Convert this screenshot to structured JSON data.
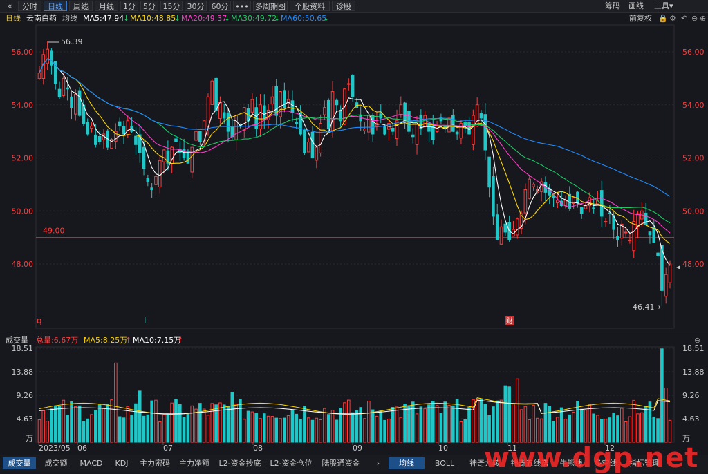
{
  "toolbar": {
    "back": "«",
    "tabs": [
      "分时",
      "日线",
      "周线",
      "月线",
      "1分",
      "5分",
      "15分",
      "30分",
      "60分",
      "•••",
      "多周期图",
      "个股资料",
      "诊股"
    ],
    "active_tab": "日线",
    "right": [
      "筹码",
      "画线",
      "工具▾"
    ]
  },
  "info": {
    "period": "日线",
    "name": "云南白药",
    "ma_label": "均线",
    "ma5": "MA5:47.94",
    "ma10": "MA10:48.85",
    "ma20": "MA20:49.37",
    "ma30": "MA30:49.72",
    "ma60": "MA60:50.65",
    "fq": "前复权"
  },
  "colors": {
    "up": "#ff3c3c",
    "down": "#1ec8c8",
    "ma5": "#ffffff",
    "ma10": "#ffd600",
    "ma20": "#ff3cc8",
    "ma30": "#1ec864",
    "ma60": "#1e8cff",
    "axis_text": "#ff3c3c",
    "hline": "#c83232"
  },
  "price_axis": {
    "ticks": [
      "56.00",
      "54.00",
      "52.00",
      "50.00",
      "48.00"
    ],
    "values": [
      56,
      54,
      52,
      50,
      48
    ]
  },
  "markers": {
    "high": "56.39",
    "low": "46.41",
    "hline_label": "49.00",
    "hline_value": 49,
    "q": "q",
    "l": "L",
    "cai": "财"
  },
  "volume": {
    "title": "成交量",
    "total": "总量:6.67万",
    "ma5": "MA5:8.25万",
    "ma10": "MA10:7.15万",
    "axis_ticks": [
      "18.51",
      "13.88",
      "9.26",
      "4.63",
      "万"
    ],
    "values": [
      18.51,
      13.88,
      9.26,
      4.63
    ]
  },
  "x_axis": {
    "labels": [
      "2023/05",
      "06",
      "07",
      "08",
      "09",
      "10",
      "11",
      "12"
    ]
  },
  "bottom_tabs": [
    "成交量",
    "成交额",
    "MACD",
    "KDJ",
    "主力密码",
    "主力净额",
    "L2-资金抄底",
    "L2-资金仓位",
    "陆股通资金"
  ],
  "bottom_tabs_right": [
    "均线",
    "BOLL",
    "神奇九转",
    "神奇五线谱",
    "牛熊线",
    "多空线",
    "指标管理"
  ],
  "watermark": "www.dgp.net",
  "chart_data": {
    "type": "candlestick",
    "period": "daily",
    "ylim": [
      46.0,
      56.8
    ],
    "ma_lines": [
      "MA5",
      "MA10",
      "MA20",
      "MA30",
      "MA60"
    ],
    "highest": 56.39,
    "lowest": 46.41,
    "reference_line": 49.0,
    "volume_axis_max": 18.51,
    "volume_unit": "万"
  }
}
